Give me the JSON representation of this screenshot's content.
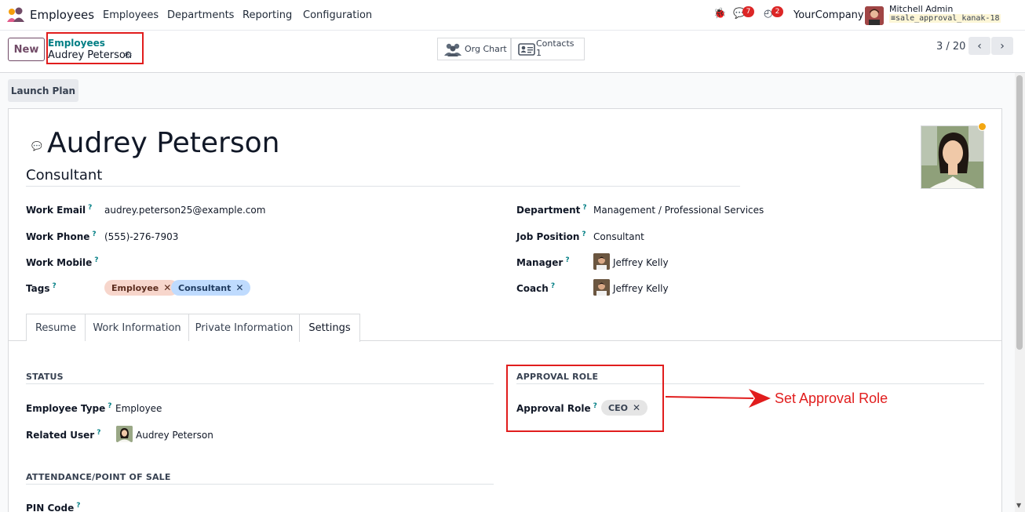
{
  "navbar": {
    "app_name": "Employees",
    "menu": [
      "Employees",
      "Departments",
      "Reporting",
      "Configuration"
    ],
    "messages_count": "7",
    "activities_count": "2",
    "company": "YourCompany",
    "user": "Mitchell Admin",
    "database": "sale_approval_kanak-18"
  },
  "control": {
    "new_label": "New",
    "breadcrumb_parent": "Employees",
    "breadcrumb_current": "Audrey Peterson",
    "org_chart_label": "Org Chart",
    "contacts_label": "Contacts",
    "contacts_count": "1",
    "pager": "3 / 20"
  },
  "launch_plan_label": "Launch Plan",
  "employee": {
    "name": "Audrey Peterson",
    "job_title": "Consultant",
    "status_color": "#f3a712"
  },
  "fields": {
    "work_email_label": "Work Email",
    "work_email": "audrey.peterson25@example.com",
    "work_phone_label": "Work Phone",
    "work_phone": "(555)-276-7903",
    "work_mobile_label": "Work Mobile",
    "tags_label": "Tags",
    "tags": [
      {
        "label": "Employee",
        "color": "#f7d6cc"
      },
      {
        "label": "Consultant",
        "color": "#bfdbfe"
      }
    ],
    "department_label": "Department",
    "department": "Management / Professional Services",
    "job_position_label": "Job Position",
    "job_position": "Consultant",
    "manager_label": "Manager",
    "manager": "Jeffrey Kelly",
    "coach_label": "Coach",
    "coach": "Jeffrey Kelly"
  },
  "tabs": [
    "Resume",
    "Work Information",
    "Private Information",
    "Settings"
  ],
  "settings": {
    "status_section": "STATUS",
    "employee_type_label": "Employee Type",
    "employee_type": "Employee",
    "related_user_label": "Related User",
    "related_user": "Audrey Peterson",
    "approval_section": "APPROVAL ROLE",
    "approval_role_label": "Approval Role",
    "approval_role": "CEO",
    "attendance_section": "ATTENDANCE/POINT OF SALE",
    "pin_code_label": "PIN Code"
  },
  "annotation": "Set Approval Role",
  "help_mark": "?"
}
